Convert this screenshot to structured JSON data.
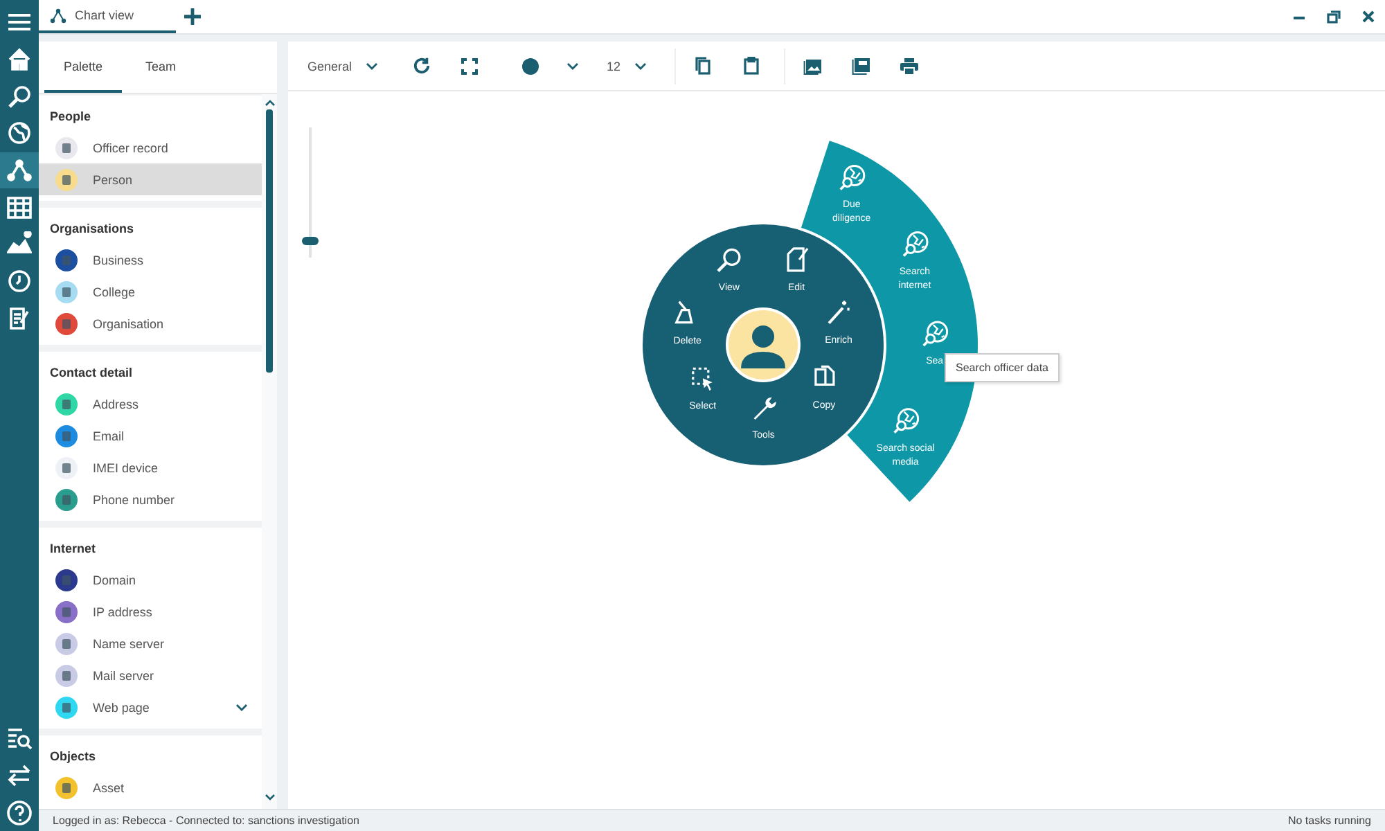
{
  "nav_rail": {
    "items": [
      {
        "selected": false
      },
      {
        "selected": false
      },
      {
        "selected": false
      },
      {
        "selected": true
      },
      {
        "selected": false
      },
      {
        "selected": false
      },
      {
        "selected": false
      },
      {
        "selected": false
      }
    ],
    "bottom_items": [
      {
        "selected": false
      },
      {
        "selected": false
      },
      {
        "selected": false
      }
    ]
  },
  "doc_tabs": [
    {
      "label": "Chart view",
      "selected": true
    }
  ],
  "panel_tabs": [
    {
      "label": "Palette",
      "selected": true
    },
    {
      "label": "Team",
      "selected": false
    }
  ],
  "palette": [
    {
      "heading": "People",
      "items": [
        {
          "label": "Officer record",
          "color": "#e8e8ee",
          "selected": false,
          "expandable": false
        },
        {
          "label": "Person",
          "color": "#f7dc8e",
          "selected": true,
          "expandable": false
        }
      ]
    },
    {
      "heading": "Organisations",
      "items": [
        {
          "label": "Business",
          "color": "#1d4fa0",
          "selected": false,
          "expandable": false
        },
        {
          "label": "College",
          "color": "#a6dcf2",
          "selected": false,
          "expandable": false
        },
        {
          "label": "Organisation",
          "color": "#e04a3c",
          "selected": false,
          "expandable": false
        }
      ]
    },
    {
      "heading": "Contact detail",
      "items": [
        {
          "label": "Address",
          "color": "#2fd6a6",
          "selected": false,
          "expandable": false
        },
        {
          "label": "Email",
          "color": "#1c8be0",
          "selected": false,
          "expandable": false
        },
        {
          "label": "IMEI device",
          "color": "#eef2f6",
          "selected": false,
          "expandable": false
        },
        {
          "label": "Phone number",
          "color": "#2a9d8f",
          "selected": false,
          "expandable": false
        }
      ]
    },
    {
      "heading": "Internet",
      "items": [
        {
          "label": "Domain",
          "color": "#2b3a8c",
          "selected": false,
          "expandable": false
        },
        {
          "label": "IP address",
          "color": "#8a6fc8",
          "selected": false,
          "expandable": false
        },
        {
          "label": "Name server",
          "color": "#c9cbe6",
          "selected": false,
          "expandable": false
        },
        {
          "label": "Mail server",
          "color": "#c9cbe6",
          "selected": false,
          "expandable": false
        },
        {
          "label": "Web page",
          "color": "#2fd8f0",
          "selected": false,
          "expandable": true
        }
      ]
    },
    {
      "heading": "Objects",
      "items": [
        {
          "label": "Asset",
          "color": "#f2c12e",
          "selected": false,
          "expandable": false
        }
      ]
    }
  ],
  "toolbar": {
    "style": "General",
    "font_size": "12"
  },
  "zoom_slider": {
    "level": 0.13
  },
  "radial_menu": {
    "items": [
      "View",
      "Edit",
      "Enrich",
      "Copy",
      "Tools",
      "Select",
      "Delete"
    ],
    "submenu": [
      "Due diligence",
      "Search internet",
      "Sea",
      "Search social media"
    ],
    "tooltip": "Search officer data"
  },
  "status_bar": {
    "left": "Logged in as: Rebecca - Connected to: sanctions investigation",
    "right": "No tasks running"
  }
}
